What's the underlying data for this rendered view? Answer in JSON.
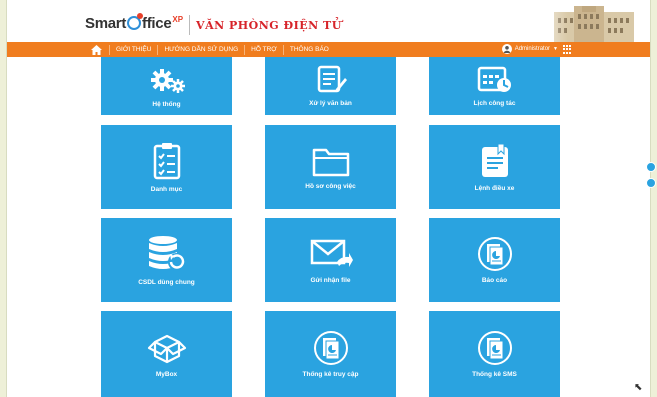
{
  "header": {
    "logo_main": "Smart",
    "logo_main2": "ffice",
    "logo_xp": "XP",
    "logo_sub": "VĂN PHÒNG ĐIỆN TỬ"
  },
  "nav": {
    "items": [
      "GIỚI THIỆU",
      "HƯỚNG DẪN SỬ DỤNG",
      "HỖ TRỢ",
      "THÔNG BÁO"
    ],
    "user": "Administrator"
  },
  "tiles": [
    {
      "label": "Hệ thống",
      "icon": "gears-icon"
    },
    {
      "label": "Xử lý văn bản",
      "icon": "document-edit-icon"
    },
    {
      "label": "Lịch công tác",
      "icon": "calendar-clock-icon"
    },
    {
      "label": "Danh mục",
      "icon": "checklist-icon"
    },
    {
      "label": "Hồ sơ công việc",
      "icon": "folder-icon"
    },
    {
      "label": "Lệnh điều xe",
      "icon": "clipboard-note-icon"
    },
    {
      "label": "CSDL dùng chung",
      "icon": "database-refresh-icon"
    },
    {
      "label": "Gửi nhận file",
      "icon": "mail-send-icon"
    },
    {
      "label": "Báo cáo",
      "icon": "report-icon"
    },
    {
      "label": "MyBox",
      "icon": "box-icon"
    },
    {
      "label": "Thống kê truy cập",
      "icon": "stats-access-icon"
    },
    {
      "label": "Thống kê SMS",
      "icon": "stats-sms-icon"
    }
  ],
  "colors": {
    "tile": "#2aa3e0",
    "navbar": "#f07d1f",
    "brand_red": "#d7242a"
  }
}
